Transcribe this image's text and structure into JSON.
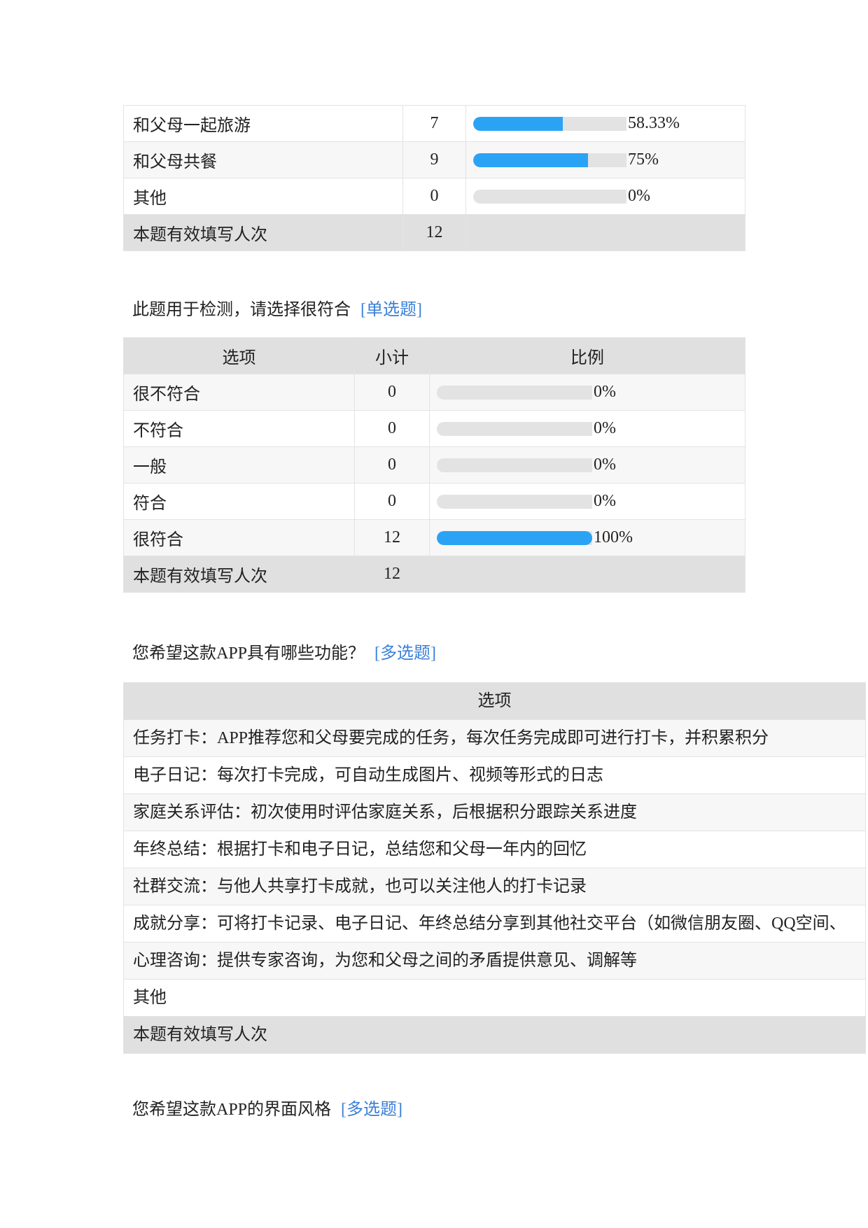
{
  "colors": {
    "bar_fill": "#2aa3f5",
    "bar_track": "#e3e3e3",
    "header_bg": "#e0e0e0",
    "qtype_link": "#3a80d8"
  },
  "table1": {
    "rows": [
      {
        "option": "和父母一起旅游",
        "count": "7",
        "percent": "58.33%",
        "fraction": 0.5833
      },
      {
        "option": "和父母共餐",
        "count": "9",
        "percent": "75%",
        "fraction": 0.75
      },
      {
        "option": "其他",
        "count": "0",
        "percent": "0%",
        "fraction": 0
      }
    ],
    "total_label": "本题有效填写人次",
    "total_count": "12"
  },
  "q2": {
    "title": "此题用于检测，请选择很符合",
    "type": "[单选题]",
    "headers": {
      "option": "选项",
      "count": "小计",
      "ratio": "比例"
    },
    "rows": [
      {
        "option": "很不符合",
        "count": "0",
        "percent": "0%",
        "fraction": 0
      },
      {
        "option": "不符合",
        "count": "0",
        "percent": "0%",
        "fraction": 0
      },
      {
        "option": "一般",
        "count": "0",
        "percent": "0%",
        "fraction": 0
      },
      {
        "option": "符合",
        "count": "0",
        "percent": "0%",
        "fraction": 0
      },
      {
        "option": "很符合",
        "count": "12",
        "percent": "100%",
        "fraction": 1
      }
    ],
    "total_label": "本题有效填写人次",
    "total_count": "12"
  },
  "q3": {
    "title": "您希望这款APP具有哪些功能？",
    "type": "[多选题]",
    "headers": {
      "option": "选项"
    },
    "rows": [
      "任务打卡：APP推荐您和父母要完成的任务，每次任务完成即可进行打卡，并积累积分",
      "电子日记：每次打卡完成，可自动生成图片、视频等形式的日志",
      "家庭关系评估：初次使用时评估家庭关系，后根据积分跟踪关系进度",
      "年终总结：根据打卡和电子日记，总结您和父母一年内的回忆",
      "社群交流：与他人共享打卡成就，也可以关注他人的打卡记录",
      "成就分享：可将打卡记录、电子日记、年终总结分享到其他社交平台（如微信朋友圈、QQ空间、",
      "心理咨询：提供专家咨询，为您和父母之间的矛盾提供意见、调解等",
      "其他"
    ],
    "total_label": "本题有效填写人次"
  },
  "q4": {
    "title": "您希望这款APP的界面风格",
    "type": "[多选题]"
  }
}
